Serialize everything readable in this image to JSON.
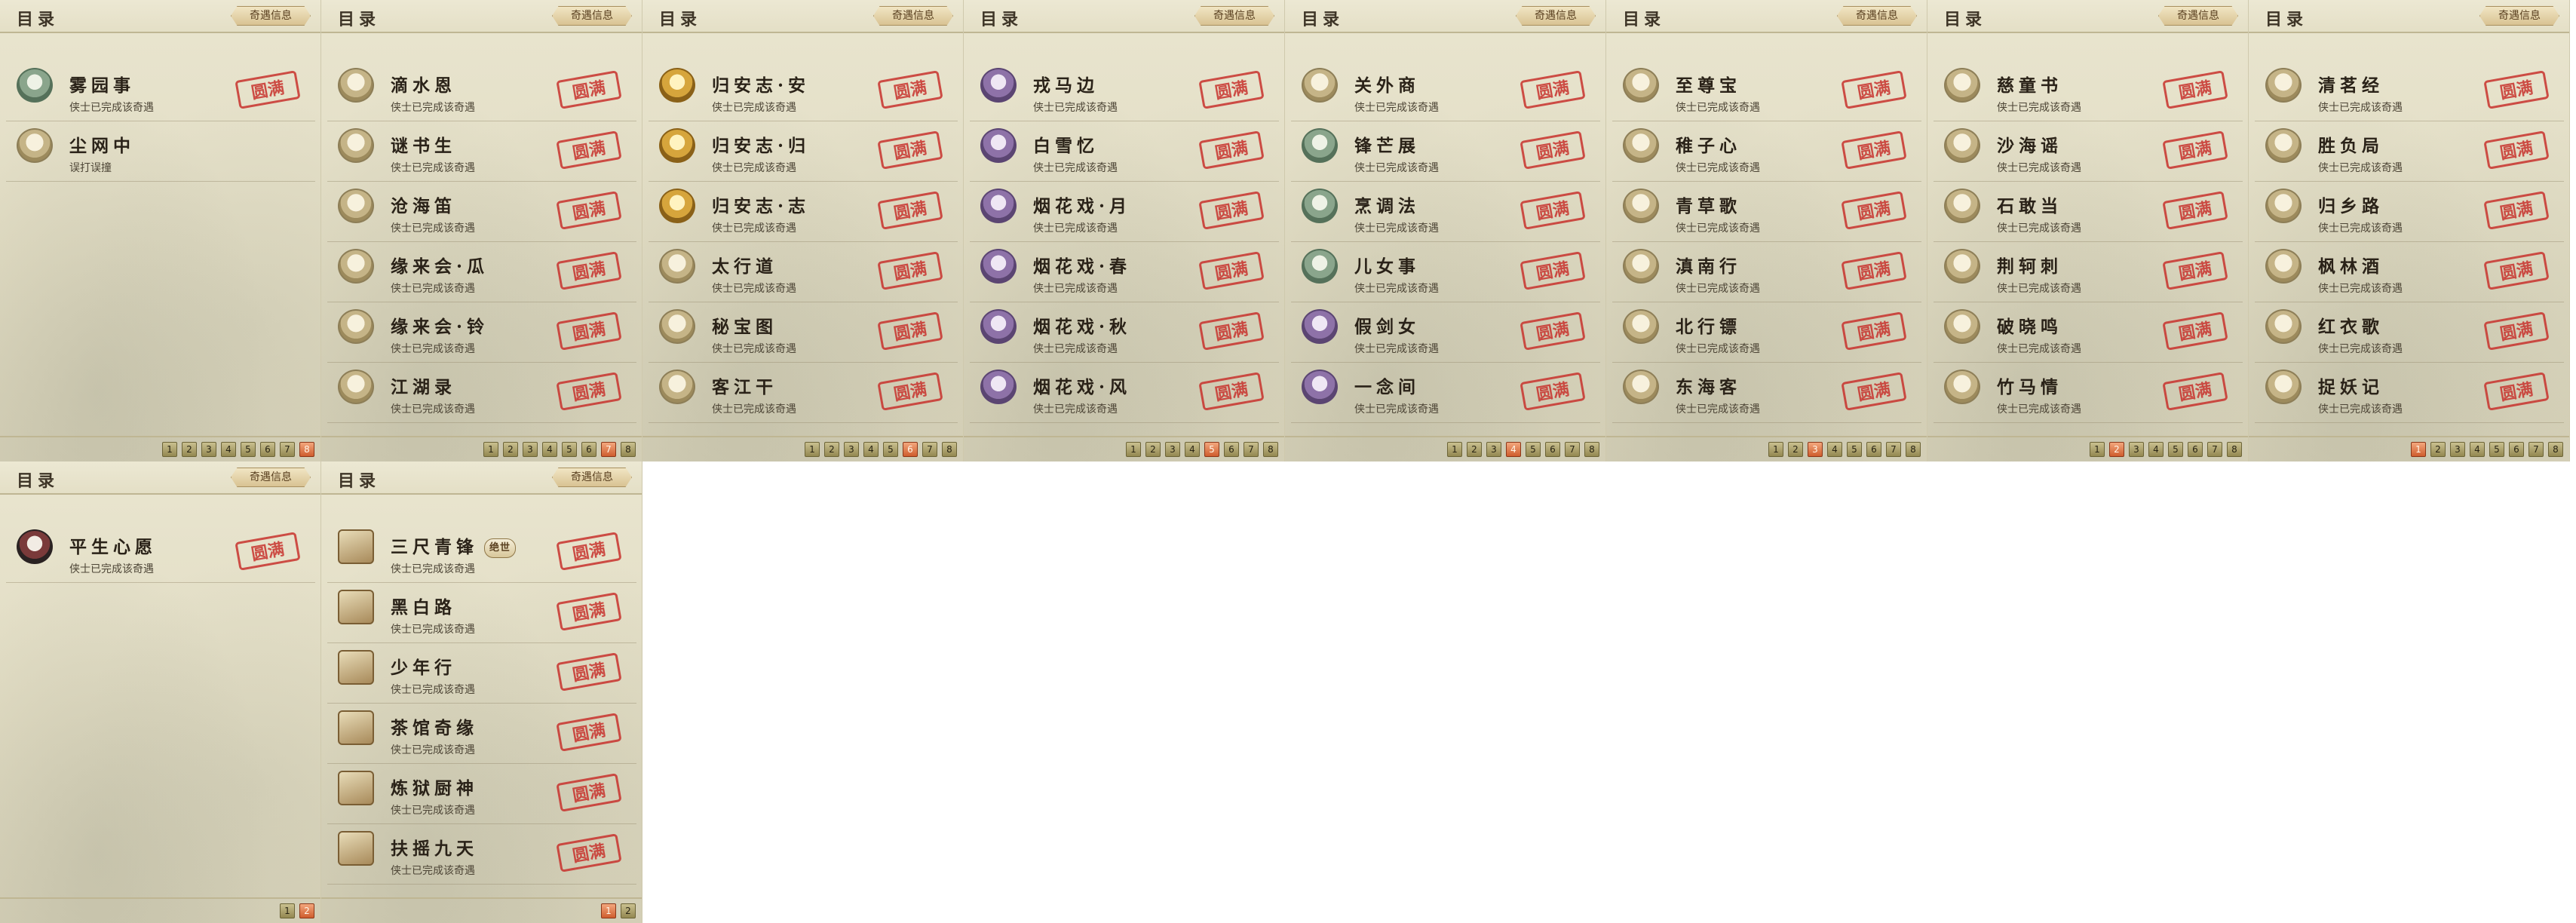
{
  "labels": {
    "panel_title": "目录",
    "info_button": "奇遇信息",
    "stamp": "圆满"
  },
  "panels": [
    {
      "entries": [
        {
          "title": "雾园事",
          "subtitle": "侠士已完成该奇遇",
          "avatar": "flower-icon",
          "completed": true
        },
        {
          "title": "尘网中",
          "subtitle": "误打误撞",
          "avatar": "cat-icon",
          "completed": false
        }
      ],
      "pages": [
        "1",
        "2",
        "3",
        "4",
        "5",
        "6",
        "7",
        "8"
      ],
      "active_page": "8"
    },
    {
      "entries": [
        {
          "title": "滴水恩",
          "subtitle": "侠士已完成该奇遇",
          "avatar": "cat-icon",
          "completed": true
        },
        {
          "title": "谜书生",
          "subtitle": "侠士已完成该奇遇",
          "avatar": "cat-icon",
          "completed": true
        },
        {
          "title": "沧海笛",
          "subtitle": "侠士已完成该奇遇",
          "avatar": "cat-icon",
          "completed": true
        },
        {
          "title": "缘来会·瓜",
          "subtitle": "侠士已完成该奇遇",
          "avatar": "cat-icon",
          "completed": true
        },
        {
          "title": "缘来会·铃",
          "subtitle": "侠士已完成该奇遇",
          "avatar": "cat-icon",
          "completed": true
        },
        {
          "title": "江湖录",
          "subtitle": "侠士已完成该奇遇",
          "avatar": "cat-icon",
          "completed": true
        }
      ],
      "pages": [
        "1",
        "2",
        "3",
        "4",
        "5",
        "6",
        "7",
        "8"
      ],
      "active_page": "7"
    },
    {
      "entries": [
        {
          "title": "归安志·安",
          "subtitle": "侠士已完成该奇遇",
          "avatar": "gold-statue-icon",
          "completed": true
        },
        {
          "title": "归安志·归",
          "subtitle": "侠士已完成该奇遇",
          "avatar": "gold-statue-icon",
          "completed": true
        },
        {
          "title": "归安志·志",
          "subtitle": "侠士已完成该奇遇",
          "avatar": "gold-statue-icon",
          "completed": true
        },
        {
          "title": "太行道",
          "subtitle": "侠士已完成该奇遇",
          "avatar": "cat-icon",
          "completed": true
        },
        {
          "title": "秘宝图",
          "subtitle": "侠士已完成该奇遇",
          "avatar": "cat-icon",
          "completed": true
        },
        {
          "title": "客江干",
          "subtitle": "侠士已完成该奇遇",
          "avatar": "cat-icon",
          "completed": true
        }
      ],
      "pages": [
        "1",
        "2",
        "3",
        "4",
        "5",
        "6",
        "7",
        "8"
      ],
      "active_page": "6"
    },
    {
      "entries": [
        {
          "title": "戎马边",
          "subtitle": "侠士已完成该奇遇",
          "avatar": "purple-figure-icon",
          "completed": true
        },
        {
          "title": "白雪忆",
          "subtitle": "侠士已完成该奇遇",
          "avatar": "purple-figure-icon",
          "completed": true
        },
        {
          "title": "烟花戏·月",
          "subtitle": "侠士已完成该奇遇",
          "avatar": "purple-figure-icon",
          "completed": true
        },
        {
          "title": "烟花戏·春",
          "subtitle": "侠士已完成该奇遇",
          "avatar": "purple-figure-icon",
          "completed": true
        },
        {
          "title": "烟花戏·秋",
          "subtitle": "侠士已完成该奇遇",
          "avatar": "purple-figure-icon",
          "completed": true
        },
        {
          "title": "烟花戏·风",
          "subtitle": "侠士已完成该奇遇",
          "avatar": "purple-figure-icon",
          "completed": true
        }
      ],
      "pages": [
        "1",
        "2",
        "3",
        "4",
        "5",
        "6",
        "7",
        "8"
      ],
      "active_page": "5"
    },
    {
      "entries": [
        {
          "title": "关外商",
          "subtitle": "侠士已完成该奇遇",
          "avatar": "cat-icon",
          "completed": true
        },
        {
          "title": "锋芒展",
          "subtitle": "侠士已完成该奇遇",
          "avatar": "green-figure-icon",
          "completed": true
        },
        {
          "title": "烹调法",
          "subtitle": "侠士已完成该奇遇",
          "avatar": "green-figure-icon",
          "completed": true
        },
        {
          "title": "儿女事",
          "subtitle": "侠士已完成该奇遇",
          "avatar": "green-figure-icon",
          "completed": true
        },
        {
          "title": "假剑女",
          "subtitle": "侠士已完成该奇遇",
          "avatar": "purple-figure-icon",
          "completed": true
        },
        {
          "title": "一念间",
          "subtitle": "侠士已完成该奇遇",
          "avatar": "purple-figure-icon",
          "completed": true
        }
      ],
      "pages": [
        "1",
        "2",
        "3",
        "4",
        "5",
        "6",
        "7",
        "8"
      ],
      "active_page": "4"
    },
    {
      "entries": [
        {
          "title": "至尊宝",
          "subtitle": "侠士已完成该奇遇",
          "avatar": "cat-icon",
          "completed": true
        },
        {
          "title": "稚子心",
          "subtitle": "侠士已完成该奇遇",
          "avatar": "cat-icon",
          "completed": true
        },
        {
          "title": "青草歌",
          "subtitle": "侠士已完成该奇遇",
          "avatar": "cat-icon",
          "completed": true
        },
        {
          "title": "滇南行",
          "subtitle": "侠士已完成该奇遇",
          "avatar": "cat-icon",
          "completed": true
        },
        {
          "title": "北行镖",
          "subtitle": "侠士已完成该奇遇",
          "avatar": "cat-icon",
          "completed": true
        },
        {
          "title": "东海客",
          "subtitle": "侠士已完成该奇遇",
          "avatar": "cat-icon",
          "completed": true
        }
      ],
      "pages": [
        "1",
        "2",
        "3",
        "4",
        "5",
        "6",
        "7",
        "8"
      ],
      "active_page": "3"
    },
    {
      "entries": [
        {
          "title": "慈童书",
          "subtitle": "侠士已完成该奇遇",
          "avatar": "cat-icon",
          "completed": true
        },
        {
          "title": "沙海谣",
          "subtitle": "侠士已完成该奇遇",
          "avatar": "cat-icon",
          "completed": true
        },
        {
          "title": "石敢当",
          "subtitle": "侠士已完成该奇遇",
          "avatar": "cat-icon",
          "completed": true
        },
        {
          "title": "荆轲刺",
          "subtitle": "侠士已完成该奇遇",
          "avatar": "cat-icon",
          "completed": true
        },
        {
          "title": "破晓鸣",
          "subtitle": "侠士已完成该奇遇",
          "avatar": "cat-icon",
          "completed": true
        },
        {
          "title": "竹马情",
          "subtitle": "侠士已完成该奇遇",
          "avatar": "cat-icon",
          "completed": true
        }
      ],
      "pages": [
        "1",
        "2",
        "3",
        "4",
        "5",
        "6",
        "7",
        "8"
      ],
      "active_page": "2"
    },
    {
      "entries": [
        {
          "title": "清茗经",
          "subtitle": "侠士已完成该奇遇",
          "avatar": "cat-icon",
          "completed": true
        },
        {
          "title": "胜负局",
          "subtitle": "侠士已完成该奇遇",
          "avatar": "cat-icon",
          "completed": true
        },
        {
          "title": "归乡路",
          "subtitle": "侠士已完成该奇遇",
          "avatar": "cat-icon",
          "completed": true
        },
        {
          "title": "枫林酒",
          "subtitle": "侠士已完成该奇遇",
          "avatar": "cat-icon",
          "completed": true
        },
        {
          "title": "红衣歌",
          "subtitle": "侠士已完成该奇遇",
          "avatar": "cat-icon",
          "completed": true
        },
        {
          "title": "捉妖记",
          "subtitle": "侠士已完成该奇遇",
          "avatar": "cat-icon",
          "completed": true
        }
      ],
      "pages": [
        "1",
        "2",
        "3",
        "4",
        "5",
        "6",
        "7",
        "8"
      ],
      "active_page": "1"
    },
    {
      "entries": [
        {
          "title": "平生心愿",
          "subtitle": "侠士已完成该奇遇",
          "avatar": "girl-figure-icon",
          "completed": true
        }
      ],
      "pages": [
        "1",
        "2"
      ],
      "active_page": "2"
    },
    {
      "entries": [
        {
          "title": "三尺青锋",
          "subtitle": "侠士已完成该奇遇",
          "avatar": "sword-item-icon",
          "completed": true,
          "tag": "绝世"
        },
        {
          "title": "黑白路",
          "subtitle": "侠士已完成该奇遇",
          "avatar": "go-board-icon",
          "completed": true
        },
        {
          "title": "少年行",
          "subtitle": "侠士已完成该奇遇",
          "avatar": "hat-item-icon",
          "completed": true
        },
        {
          "title": "茶馆奇缘",
          "subtitle": "侠士已完成该奇遇",
          "avatar": "book-item-icon",
          "completed": true
        },
        {
          "title": "炼狱厨神",
          "subtitle": "侠士已完成该奇遇",
          "avatar": "pot-item-icon",
          "completed": true
        },
        {
          "title": "扶摇九天",
          "subtitle": "侠士已完成该奇遇",
          "avatar": "coins-item-icon",
          "completed": true
        }
      ],
      "pages": [
        "1",
        "2"
      ],
      "active_page": "1"
    }
  ]
}
